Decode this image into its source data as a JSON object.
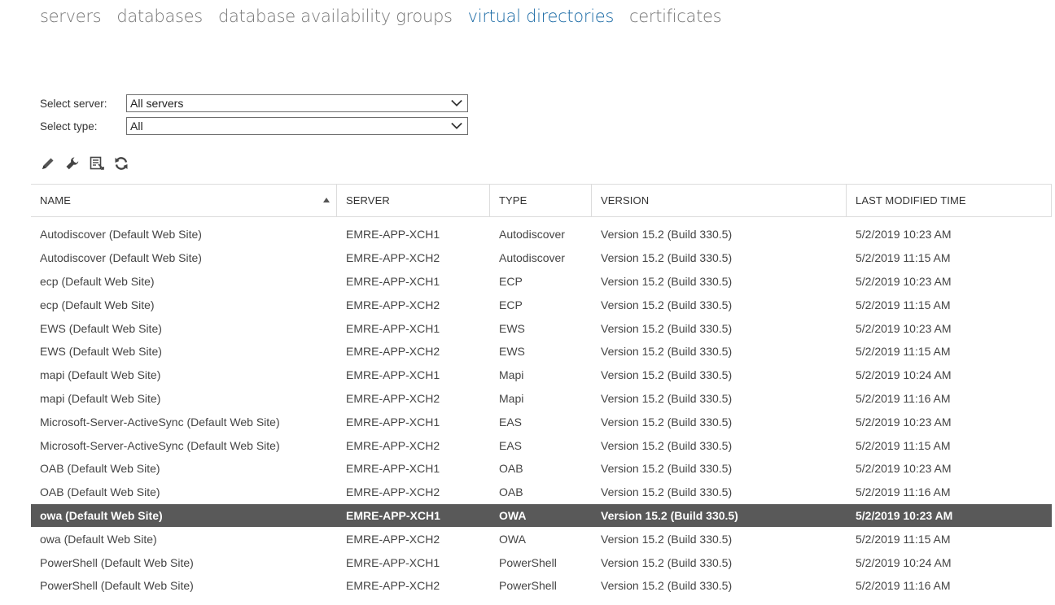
{
  "tabs": [
    {
      "label": "servers",
      "active": false
    },
    {
      "label": "databases",
      "active": false
    },
    {
      "label": "database availability groups",
      "active": false
    },
    {
      "label": "virtual directories",
      "active": true
    },
    {
      "label": "certificates",
      "active": false
    }
  ],
  "filters": {
    "server_label": "Select server:",
    "server_value": "All servers",
    "type_label": "Select type:",
    "type_value": "All"
  },
  "toolbar": {
    "icons": [
      "edit-pencil-icon",
      "wrench-icon",
      "reset-directory-icon",
      "refresh-icon"
    ]
  },
  "colors": {
    "accent": "#1a6aa5",
    "selected_row": "#595959"
  },
  "table": {
    "columns": [
      "NAME",
      "SERVER",
      "TYPE",
      "VERSION",
      "LAST MODIFIED TIME"
    ],
    "sort_column": "NAME",
    "sort_direction": "ascending",
    "rows": [
      {
        "name": "Autodiscover (Default Web Site)",
        "server": "EMRE-APP-XCH1",
        "type": "Autodiscover",
        "version": "Version 15.2 (Build 330.5)",
        "modified": "5/2/2019 10:23 AM",
        "selected": false
      },
      {
        "name": "Autodiscover (Default Web Site)",
        "server": "EMRE-APP-XCH2",
        "type": "Autodiscover",
        "version": "Version 15.2 (Build 330.5)",
        "modified": "5/2/2019 11:15 AM",
        "selected": false
      },
      {
        "name": "ecp (Default Web Site)",
        "server": "EMRE-APP-XCH1",
        "type": "ECP",
        "version": "Version 15.2 (Build 330.5)",
        "modified": "5/2/2019 10:23 AM",
        "selected": false
      },
      {
        "name": "ecp (Default Web Site)",
        "server": "EMRE-APP-XCH2",
        "type": "ECP",
        "version": "Version 15.2 (Build 330.5)",
        "modified": "5/2/2019 11:15 AM",
        "selected": false
      },
      {
        "name": "EWS (Default Web Site)",
        "server": "EMRE-APP-XCH1",
        "type": "EWS",
        "version": "Version 15.2 (Build 330.5)",
        "modified": "5/2/2019 10:23 AM",
        "selected": false
      },
      {
        "name": "EWS (Default Web Site)",
        "server": "EMRE-APP-XCH2",
        "type": "EWS",
        "version": "Version 15.2 (Build 330.5)",
        "modified": "5/2/2019 11:15 AM",
        "selected": false
      },
      {
        "name": "mapi (Default Web Site)",
        "server": "EMRE-APP-XCH1",
        "type": "Mapi",
        "version": "Version 15.2 (Build 330.5)",
        "modified": "5/2/2019 10:24 AM",
        "selected": false
      },
      {
        "name": "mapi (Default Web Site)",
        "server": "EMRE-APP-XCH2",
        "type": "Mapi",
        "version": "Version 15.2 (Build 330.5)",
        "modified": "5/2/2019 11:16 AM",
        "selected": false
      },
      {
        "name": "Microsoft-Server-ActiveSync (Default Web Site)",
        "server": "EMRE-APP-XCH1",
        "type": "EAS",
        "version": "Version 15.2 (Build 330.5)",
        "modified": "5/2/2019 10:23 AM",
        "selected": false
      },
      {
        "name": "Microsoft-Server-ActiveSync (Default Web Site)",
        "server": "EMRE-APP-XCH2",
        "type": "EAS",
        "version": "Version 15.2 (Build 330.5)",
        "modified": "5/2/2019 11:15 AM",
        "selected": false
      },
      {
        "name": "OAB (Default Web Site)",
        "server": "EMRE-APP-XCH1",
        "type": "OAB",
        "version": "Version 15.2 (Build 330.5)",
        "modified": "5/2/2019 10:23 AM",
        "selected": false
      },
      {
        "name": "OAB (Default Web Site)",
        "server": "EMRE-APP-XCH2",
        "type": "OAB",
        "version": "Version 15.2 (Build 330.5)",
        "modified": "5/2/2019 11:16 AM",
        "selected": false
      },
      {
        "name": "owa (Default Web Site)",
        "server": "EMRE-APP-XCH1",
        "type": "OWA",
        "version": "Version 15.2 (Build 330.5)",
        "modified": "5/2/2019 10:23 AM",
        "selected": true
      },
      {
        "name": "owa (Default Web Site)",
        "server": "EMRE-APP-XCH2",
        "type": "OWA",
        "version": "Version 15.2 (Build 330.5)",
        "modified": "5/2/2019 11:15 AM",
        "selected": false
      },
      {
        "name": "PowerShell (Default Web Site)",
        "server": "EMRE-APP-XCH1",
        "type": "PowerShell",
        "version": "Version 15.2 (Build 330.5)",
        "modified": "5/2/2019 10:24 AM",
        "selected": false
      },
      {
        "name": "PowerShell (Default Web Site)",
        "server": "EMRE-APP-XCH2",
        "type": "PowerShell",
        "version": "Version 15.2 (Build 330.5)",
        "modified": "5/2/2019 11:16 AM",
        "selected": false
      }
    ]
  }
}
